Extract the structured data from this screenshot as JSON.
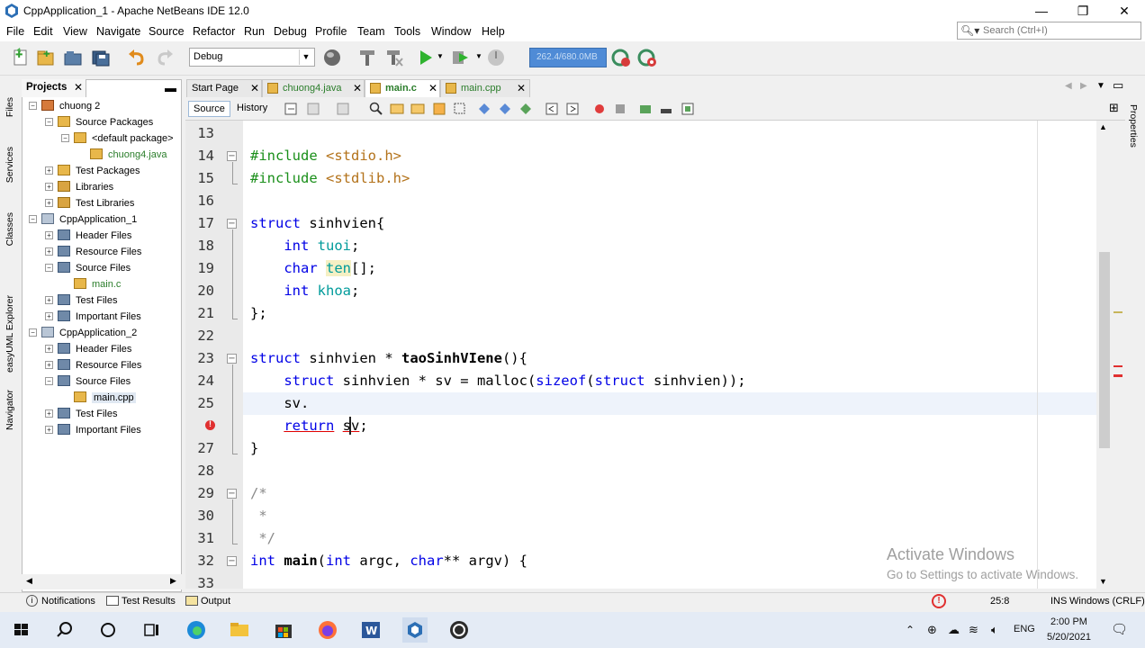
{
  "window": {
    "title": "CppApplication_1 - Apache NetBeans IDE 12.0",
    "minimize": "—",
    "maximize": "❐",
    "close": "✕"
  },
  "menu": [
    "File",
    "Edit",
    "View",
    "Navigate",
    "Source",
    "Refactor",
    "Run",
    "Debug",
    "Profile",
    "Team",
    "Tools",
    "Window",
    "Help"
  ],
  "search": {
    "placeholder": "Search (Ctrl+I)"
  },
  "toolbar": {
    "configuration": "Debug",
    "memory": "262.4/680.0MB"
  },
  "side_strip_left": [
    "Files",
    "Services",
    "Classes",
    "easyUML Explorer",
    "Navigator"
  ],
  "side_strip_right": [
    "Properties"
  ],
  "projects_panel": {
    "tab_label": "Projects",
    "tree": [
      {
        "label": "chuong 2",
        "level": 0,
        "expanded": true,
        "icon": "java-project-icon"
      },
      {
        "label": "Source Packages",
        "level": 1,
        "expanded": true,
        "icon": "package-folder-icon"
      },
      {
        "label": "<default package>",
        "level": 2,
        "expanded": true,
        "icon": "package-icon"
      },
      {
        "label": "chuong4.java",
        "level": 3,
        "icon": "java-file-icon",
        "color": "#2a7d2a"
      },
      {
        "label": "Test Packages",
        "level": 1,
        "expanded": false,
        "icon": "package-folder-icon"
      },
      {
        "label": "Libraries",
        "level": 1,
        "expanded": false,
        "icon": "library-icon"
      },
      {
        "label": "Test Libraries",
        "level": 1,
        "expanded": false,
        "icon": "library-icon"
      },
      {
        "label": "CppApplication_1",
        "level": 0,
        "expanded": true,
        "icon": "cpp-project-icon"
      },
      {
        "label": "Header Files",
        "level": 1,
        "expanded": false,
        "icon": "folder-icon"
      },
      {
        "label": "Resource Files",
        "level": 1,
        "expanded": false,
        "icon": "folder-icon"
      },
      {
        "label": "Source Files",
        "level": 1,
        "expanded": true,
        "icon": "folder-icon"
      },
      {
        "label": "main.c",
        "level": 2,
        "icon": "c-file-icon",
        "color": "#2a7d2a"
      },
      {
        "label": "Test Files",
        "level": 1,
        "expanded": false,
        "icon": "folder-icon"
      },
      {
        "label": "Important Files",
        "level": 1,
        "expanded": false,
        "icon": "folder-icon"
      },
      {
        "label": "CppApplication_2",
        "level": 0,
        "expanded": true,
        "icon": "cpp-project-icon"
      },
      {
        "label": "Header Files",
        "level": 1,
        "expanded": false,
        "icon": "folder-icon"
      },
      {
        "label": "Resource Files",
        "level": 1,
        "expanded": false,
        "icon": "folder-icon"
      },
      {
        "label": "Source Files",
        "level": 1,
        "expanded": true,
        "icon": "folder-icon"
      },
      {
        "label": "main.cpp",
        "level": 2,
        "icon": "cpp-file-icon",
        "selected": true
      },
      {
        "label": "Test Files",
        "level": 1,
        "expanded": false,
        "icon": "folder-icon"
      },
      {
        "label": "Important Files",
        "level": 1,
        "expanded": false,
        "icon": "folder-icon"
      }
    ]
  },
  "editor_tabs": [
    {
      "label": "Start Page",
      "active": false
    },
    {
      "label": "chuong4.java",
      "active": false
    },
    {
      "label": "main.c",
      "active": true
    },
    {
      "label": "main.cpp",
      "active": false
    }
  ],
  "editor_toolbar": {
    "source": "Source",
    "history": "History"
  },
  "code": {
    "line_numbers": [
      "13",
      "14",
      "15",
      "16",
      "17",
      "18",
      "19",
      "20",
      "21",
      "22",
      "23",
      "24",
      "25",
      "26",
      "27",
      "28",
      "29",
      "30",
      "31",
      "32",
      "33"
    ],
    "cursor_line": "25",
    "error_line": "26"
  },
  "watermark": {
    "line1": "Activate Windows",
    "line2": "Go to Settings to activate Windows."
  },
  "statusbar": {
    "notifications": "Notifications",
    "test_results": "Test Results",
    "output": "Output",
    "position": "25:8",
    "mode": "INS",
    "line_endings": "Windows (CRLF)"
  },
  "taskbar": {
    "language": "ENG",
    "time": "2:00 PM",
    "date": "5/20/2021"
  },
  "colors": {
    "keyword": "#0000e6",
    "preprocessor": "#1a8f1a",
    "string": "#b3721a",
    "field": "#009b9b",
    "comment": "#8a8a8a",
    "memory_bar": "#4f8bd6"
  }
}
